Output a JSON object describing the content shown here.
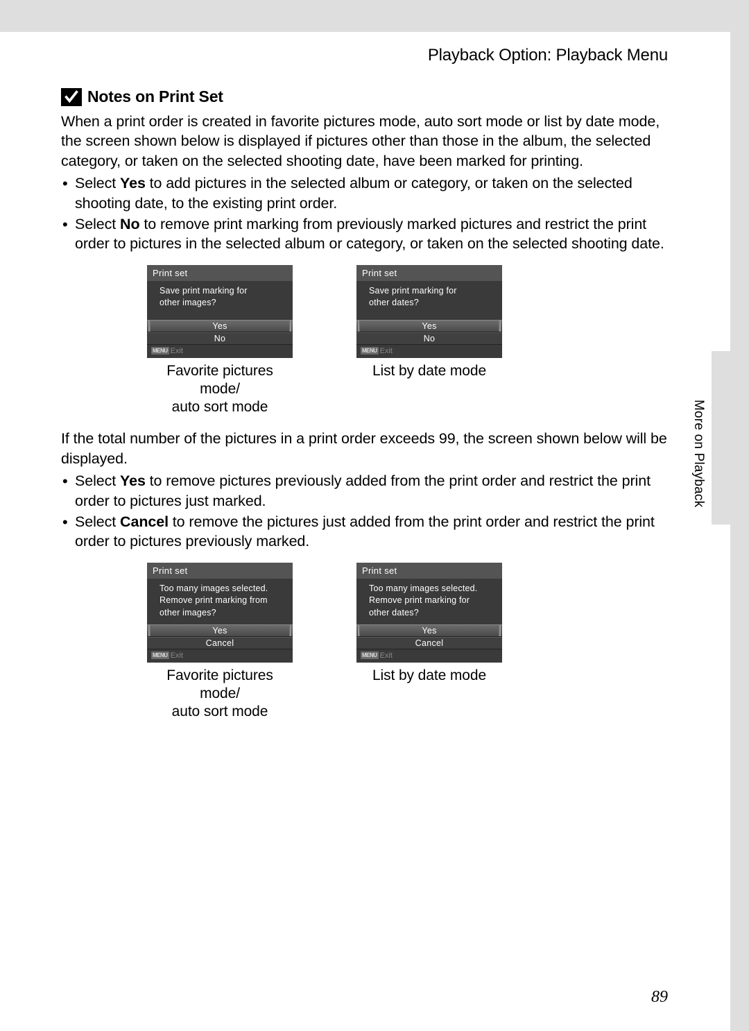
{
  "header": {
    "title": "Playback Option: Playback Menu"
  },
  "section": {
    "title": "Notes on Print Set"
  },
  "intro": "When a print order is created in favorite pictures mode, auto sort mode or list by date mode, the screen shown below is displayed if pictures other than those in the album, the selected category, or taken on the selected shooting date, have been marked for printing.",
  "bullets1": {
    "a_pre": "Select ",
    "a_bold": "Yes",
    "a_post": " to add pictures in the selected album or category, or taken on the selected shooting date, to the existing print order.",
    "b_pre": "Select ",
    "b_bold": "No",
    "b_post": " to remove print marking from previously marked pictures and restrict the print order to pictures in the selected album or category, or taken on the selected shooting date."
  },
  "screens1": {
    "left": {
      "title": "Print set",
      "msg1": "Save print marking for",
      "msg2": "other images?",
      "opt1": "Yes",
      "opt2": "No",
      "exit": "Exit",
      "caption1": "Favorite pictures mode/",
      "caption2": "auto sort mode"
    },
    "right": {
      "title": "Print set",
      "msg1": "Save print marking for",
      "msg2": "other dates?",
      "opt1": "Yes",
      "opt2": "No",
      "exit": "Exit",
      "caption1": "List by date mode"
    }
  },
  "mid": "If the total number of the pictures in a print order exceeds 99, the screen shown below will be displayed.",
  "bullets2": {
    "a_pre": "Select ",
    "a_bold": "Yes",
    "a_post": " to remove pictures previously added from the print order and restrict the print order to pictures just marked.",
    "b_pre": "Select ",
    "b_bold": "Cancel",
    "b_post": " to remove the pictures just added from the print order and restrict the print order to pictures previously marked."
  },
  "screens2": {
    "left": {
      "title": "Print set",
      "msg1": "Too many images selected.",
      "msg2": "Remove print marking from",
      "msg3": "other images?",
      "opt1": "Yes",
      "opt2": "Cancel",
      "exit": "Exit",
      "caption1": "Favorite pictures mode/",
      "caption2": "auto sort mode"
    },
    "right": {
      "title": "Print set",
      "msg1": "Too many images selected.",
      "msg2": "Remove print marking for",
      "msg3": "other dates?",
      "opt1": "Yes",
      "opt2": "Cancel",
      "exit": "Exit",
      "caption1": "List by date mode"
    }
  },
  "side": {
    "label": "More on Playback"
  },
  "pagenum": "89",
  "menu_badge": "MENU"
}
